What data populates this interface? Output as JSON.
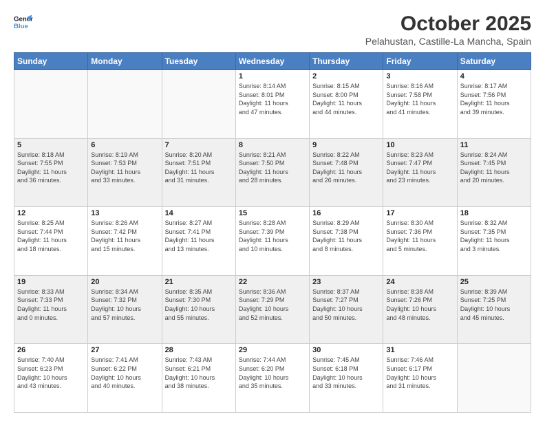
{
  "logo": {
    "line1": "General",
    "line2": "Blue"
  },
  "title": "October 2025",
  "subtitle": "Pelahustan, Castille-La Mancha, Spain",
  "weekdays": [
    "Sunday",
    "Monday",
    "Tuesday",
    "Wednesday",
    "Thursday",
    "Friday",
    "Saturday"
  ],
  "weeks": [
    [
      {
        "day": "",
        "info": ""
      },
      {
        "day": "",
        "info": ""
      },
      {
        "day": "",
        "info": ""
      },
      {
        "day": "1",
        "info": "Sunrise: 8:14 AM\nSunset: 8:01 PM\nDaylight: 11 hours\nand 47 minutes."
      },
      {
        "day": "2",
        "info": "Sunrise: 8:15 AM\nSunset: 8:00 PM\nDaylight: 11 hours\nand 44 minutes."
      },
      {
        "day": "3",
        "info": "Sunrise: 8:16 AM\nSunset: 7:58 PM\nDaylight: 11 hours\nand 41 minutes."
      },
      {
        "day": "4",
        "info": "Sunrise: 8:17 AM\nSunset: 7:56 PM\nDaylight: 11 hours\nand 39 minutes."
      }
    ],
    [
      {
        "day": "5",
        "info": "Sunrise: 8:18 AM\nSunset: 7:55 PM\nDaylight: 11 hours\nand 36 minutes."
      },
      {
        "day": "6",
        "info": "Sunrise: 8:19 AM\nSunset: 7:53 PM\nDaylight: 11 hours\nand 33 minutes."
      },
      {
        "day": "7",
        "info": "Sunrise: 8:20 AM\nSunset: 7:51 PM\nDaylight: 11 hours\nand 31 minutes."
      },
      {
        "day": "8",
        "info": "Sunrise: 8:21 AM\nSunset: 7:50 PM\nDaylight: 11 hours\nand 28 minutes."
      },
      {
        "day": "9",
        "info": "Sunrise: 8:22 AM\nSunset: 7:48 PM\nDaylight: 11 hours\nand 26 minutes."
      },
      {
        "day": "10",
        "info": "Sunrise: 8:23 AM\nSunset: 7:47 PM\nDaylight: 11 hours\nand 23 minutes."
      },
      {
        "day": "11",
        "info": "Sunrise: 8:24 AM\nSunset: 7:45 PM\nDaylight: 11 hours\nand 20 minutes."
      }
    ],
    [
      {
        "day": "12",
        "info": "Sunrise: 8:25 AM\nSunset: 7:44 PM\nDaylight: 11 hours\nand 18 minutes."
      },
      {
        "day": "13",
        "info": "Sunrise: 8:26 AM\nSunset: 7:42 PM\nDaylight: 11 hours\nand 15 minutes."
      },
      {
        "day": "14",
        "info": "Sunrise: 8:27 AM\nSunset: 7:41 PM\nDaylight: 11 hours\nand 13 minutes."
      },
      {
        "day": "15",
        "info": "Sunrise: 8:28 AM\nSunset: 7:39 PM\nDaylight: 11 hours\nand 10 minutes."
      },
      {
        "day": "16",
        "info": "Sunrise: 8:29 AM\nSunset: 7:38 PM\nDaylight: 11 hours\nand 8 minutes."
      },
      {
        "day": "17",
        "info": "Sunrise: 8:30 AM\nSunset: 7:36 PM\nDaylight: 11 hours\nand 5 minutes."
      },
      {
        "day": "18",
        "info": "Sunrise: 8:32 AM\nSunset: 7:35 PM\nDaylight: 11 hours\nand 3 minutes."
      }
    ],
    [
      {
        "day": "19",
        "info": "Sunrise: 8:33 AM\nSunset: 7:33 PM\nDaylight: 11 hours\nand 0 minutes."
      },
      {
        "day": "20",
        "info": "Sunrise: 8:34 AM\nSunset: 7:32 PM\nDaylight: 10 hours\nand 57 minutes."
      },
      {
        "day": "21",
        "info": "Sunrise: 8:35 AM\nSunset: 7:30 PM\nDaylight: 10 hours\nand 55 minutes."
      },
      {
        "day": "22",
        "info": "Sunrise: 8:36 AM\nSunset: 7:29 PM\nDaylight: 10 hours\nand 52 minutes."
      },
      {
        "day": "23",
        "info": "Sunrise: 8:37 AM\nSunset: 7:27 PM\nDaylight: 10 hours\nand 50 minutes."
      },
      {
        "day": "24",
        "info": "Sunrise: 8:38 AM\nSunset: 7:26 PM\nDaylight: 10 hours\nand 48 minutes."
      },
      {
        "day": "25",
        "info": "Sunrise: 8:39 AM\nSunset: 7:25 PM\nDaylight: 10 hours\nand 45 minutes."
      }
    ],
    [
      {
        "day": "26",
        "info": "Sunrise: 7:40 AM\nSunset: 6:23 PM\nDaylight: 10 hours\nand 43 minutes."
      },
      {
        "day": "27",
        "info": "Sunrise: 7:41 AM\nSunset: 6:22 PM\nDaylight: 10 hours\nand 40 minutes."
      },
      {
        "day": "28",
        "info": "Sunrise: 7:43 AM\nSunset: 6:21 PM\nDaylight: 10 hours\nand 38 minutes."
      },
      {
        "day": "29",
        "info": "Sunrise: 7:44 AM\nSunset: 6:20 PM\nDaylight: 10 hours\nand 35 minutes."
      },
      {
        "day": "30",
        "info": "Sunrise: 7:45 AM\nSunset: 6:18 PM\nDaylight: 10 hours\nand 33 minutes."
      },
      {
        "day": "31",
        "info": "Sunrise: 7:46 AM\nSunset: 6:17 PM\nDaylight: 10 hours\nand 31 minutes."
      },
      {
        "day": "",
        "info": ""
      }
    ]
  ]
}
